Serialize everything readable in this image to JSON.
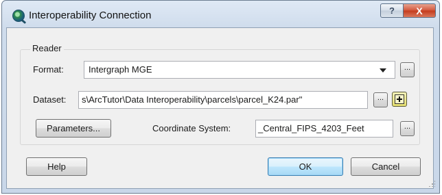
{
  "window": {
    "title": "Interoperability Connection",
    "icon": "globe-magnifier-icon",
    "help_glyph": "?",
    "close_glyph": "X"
  },
  "reader": {
    "group_label": "Reader",
    "format_label": "Format:",
    "format_value": "Intergraph MGE",
    "dataset_label": "Dataset:",
    "dataset_value": "s\\ArcTutor\\Data Interoperability\\parcels\\parcel_K24.par\"",
    "coord_label": "Coordinate System:",
    "coord_value": "_Central_FIPS_4203_Feet",
    "ellipsis": "...",
    "parameters_label": "Parameters..."
  },
  "buttons": {
    "help": "Help",
    "ok": "OK",
    "cancel": "Cancel"
  },
  "colors": {
    "title_bar": "#d3dfee",
    "close_button": "#c9452a",
    "add_button": "#e4de6e",
    "default_button_border": "#3c7fb1"
  }
}
